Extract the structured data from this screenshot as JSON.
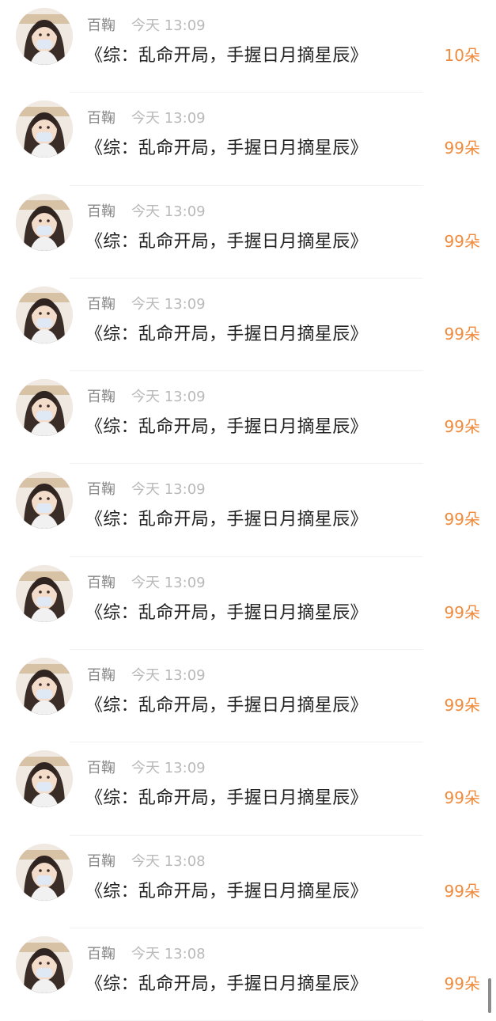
{
  "records": [
    {
      "name": "百鞠",
      "time": "今天 13:09",
      "title": "《综：乱命开局，手握日月摘星辰》",
      "amount": "10朵"
    },
    {
      "name": "百鞠",
      "time": "今天 13:09",
      "title": "《综：乱命开局，手握日月摘星辰》",
      "amount": "99朵"
    },
    {
      "name": "百鞠",
      "time": "今天 13:09",
      "title": "《综：乱命开局，手握日月摘星辰》",
      "amount": "99朵"
    },
    {
      "name": "百鞠",
      "time": "今天 13:09",
      "title": "《综：乱命开局，手握日月摘星辰》",
      "amount": "99朵"
    },
    {
      "name": "百鞠",
      "time": "今天 13:09",
      "title": "《综：乱命开局，手握日月摘星辰》",
      "amount": "99朵"
    },
    {
      "name": "百鞠",
      "time": "今天 13:09",
      "title": "《综：乱命开局，手握日月摘星辰》",
      "amount": "99朵"
    },
    {
      "name": "百鞠",
      "time": "今天 13:09",
      "title": "《综：乱命开局，手握日月摘星辰》",
      "amount": "99朵"
    },
    {
      "name": "百鞠",
      "time": "今天 13:09",
      "title": "《综：乱命开局，手握日月摘星辰》",
      "amount": "99朵"
    },
    {
      "name": "百鞠",
      "time": "今天 13:09",
      "title": "《综：乱命开局，手握日月摘星辰》",
      "amount": "99朵"
    },
    {
      "name": "百鞠",
      "time": "今天 13:08",
      "title": "《综：乱命开局，手握日月摘星辰》",
      "amount": "99朵"
    },
    {
      "name": "百鞠",
      "time": "今天 13:08",
      "title": "《综：乱命开局，手握日月摘星辰》",
      "amount": "99朵"
    }
  ],
  "colors": {
    "amount": "#f08a3c",
    "name": "#8a8a8a",
    "time": "#b9b9b9",
    "title": "#222222"
  },
  "icons": {
    "avatar": "user-avatar-photo"
  }
}
